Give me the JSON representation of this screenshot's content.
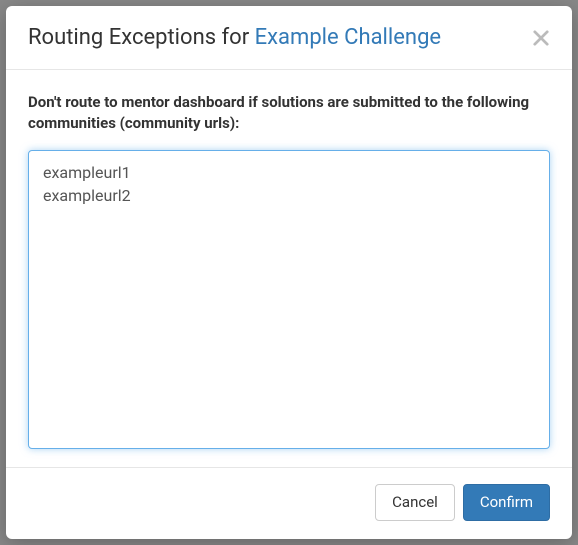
{
  "header": {
    "title_prefix": "Routing Exceptions for ",
    "title_link": "Example Challenge"
  },
  "body": {
    "instruction": "Don't route to mentor dashboard if solutions are submitted to the following communities (community urls):",
    "textarea_value": "exampleurl1\nexampleurl2"
  },
  "footer": {
    "cancel_label": "Cancel",
    "confirm_label": "Confirm"
  }
}
